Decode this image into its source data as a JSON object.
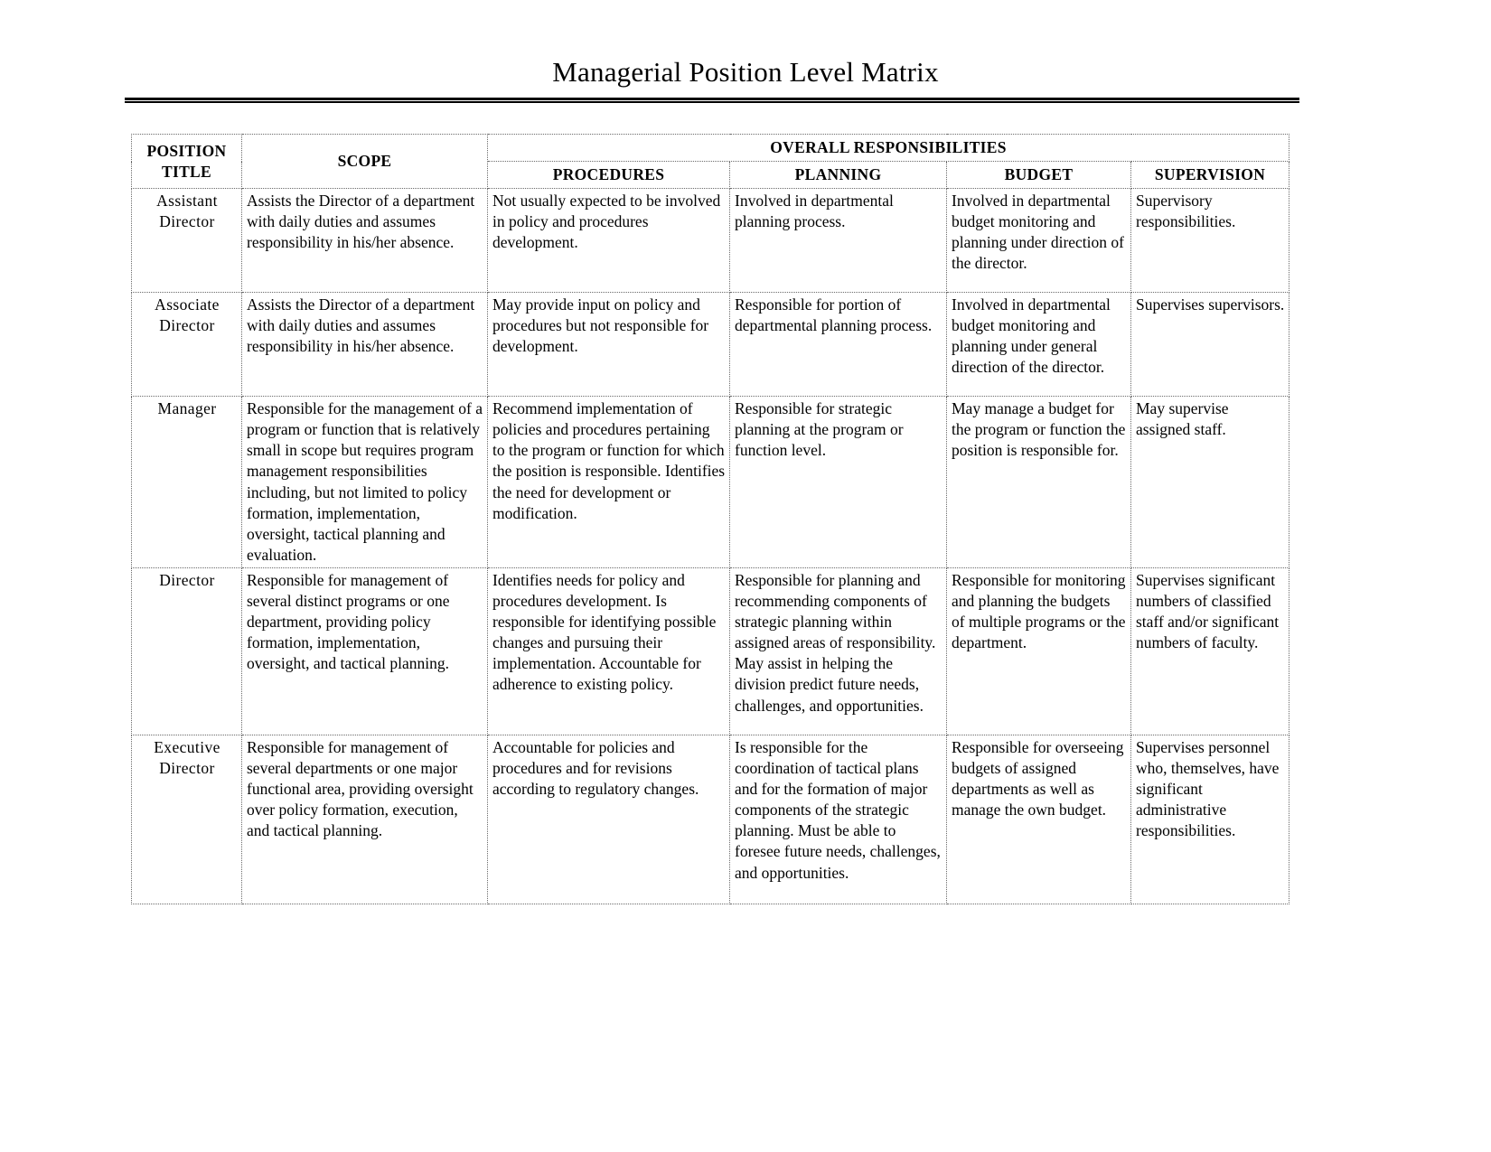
{
  "document": {
    "title": "Managerial Position Level Matrix"
  },
  "table": {
    "headers": {
      "position_title": "POSITION TITLE",
      "position_title_line1": "POSITION",
      "position_title_line2": "TITLE",
      "scope": "SCOPE",
      "overall_responsibilities": "OVERALL RESPONSIBILITIES",
      "procedures": "PROCEDURES",
      "planning": "PLANNING",
      "budget": "BUDGET",
      "supervision": "SUPERVISION"
    },
    "rows": [
      {
        "position_title": "Assistant Director",
        "position_title_line1": "Assistant",
        "position_title_line2": "Director",
        "scope": "Assists the Director of a department with daily duties and assumes responsibility in his/her absence.",
        "procedures": "Not usually expected to be involved in policy and procedures development.",
        "planning": "Involved in departmental planning process.",
        "budget": "Involved in departmental budget monitoring and planning under direction of the director.",
        "supervision": "Supervisory responsibilities."
      },
      {
        "position_title": "Associate Director",
        "position_title_line1": "Associate",
        "position_title_line2": "Director",
        "scope": "Assists the Director of a department with daily duties and assumes responsibility in his/her absence.",
        "procedures": "May provide input on policy and procedures but not responsible for development.",
        "planning": "Responsible for portion of departmental planning process.",
        "budget": "Involved in departmental budget monitoring and planning under general direction of the director.",
        "supervision": "Supervises supervisors."
      },
      {
        "position_title": "Manager",
        "position_title_line1": "Manager",
        "position_title_line2": "",
        "scope": "Responsible for the management of a program or function that is relatively small in scope but requires program management responsibilities including, but not limited to policy formation, implementation, oversight, tactical planning and evaluation.",
        "procedures": "Recommend implementation of policies and procedures pertaining to the program or function for which the position is responsible. Identifies the need for development or modification.",
        "planning": "Responsible for strategic planning at the program or function level.",
        "budget": "May manage a budget for the program or function the position is responsible for.",
        "supervision": "May supervise assigned staff."
      },
      {
        "position_title": "Director",
        "position_title_line1": "Director",
        "position_title_line2": "",
        "scope": "Responsible for management of several distinct programs or one department, providing policy formation, implementation, oversight, and tactical planning.",
        "procedures": "Identifies needs for policy and procedures development. Is responsible for identifying possible changes and pursuing their implementation. Accountable for adherence to existing policy.",
        "planning": "Responsible for planning and recommending components of strategic planning within assigned areas of responsibility. May assist in helping the division predict future needs, challenges, and opportunities.",
        "budget": "Responsible for monitoring and planning the budgets of multiple programs or the department.",
        "supervision": "Supervises significant numbers of classified staff and/or significant numbers of faculty."
      },
      {
        "position_title": "Executive Director",
        "position_title_line1": "Executive",
        "position_title_line2": "Director",
        "scope": "Responsible for management of several departments or one major functional area, providing oversight over policy formation, execution, and tactical planning.",
        "procedures": "Accountable for policies and procedures and for revisions according to regulatory changes.",
        "planning": "Is responsible for the coordination of tactical plans and for the formation of major components of the strategic planning. Must be able to foresee future needs, challenges, and opportunities.",
        "budget": "Responsible for overseeing budgets of assigned departments as well as manage the own budget.",
        "supervision": "Supervises personnel who, themselves, have significant administrative responsibilities."
      }
    ]
  }
}
